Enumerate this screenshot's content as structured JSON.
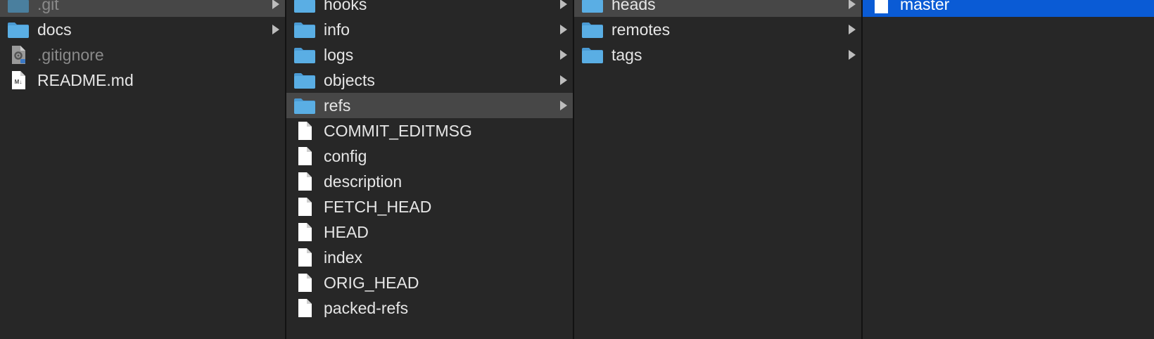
{
  "columns": [
    {
      "items": [
        {
          "label": ".git",
          "kind": "folder",
          "icon": "folder-icon",
          "state": "selected-parent",
          "dim": true,
          "has_children": true
        },
        {
          "label": "docs",
          "kind": "folder",
          "icon": "folder-icon",
          "state": "",
          "dim": false,
          "has_children": true
        },
        {
          "label": ".gitignore",
          "kind": "config-file",
          "icon": "gear-document-icon",
          "state": "",
          "dim": true,
          "has_children": false
        },
        {
          "label": "README.md",
          "kind": "markdown-file",
          "icon": "markdown-document-icon",
          "state": "",
          "dim": false,
          "has_children": false
        }
      ]
    },
    {
      "items": [
        {
          "label": "hooks",
          "kind": "folder",
          "icon": "folder-icon",
          "state": "",
          "dim": false,
          "has_children": true
        },
        {
          "label": "info",
          "kind": "folder",
          "icon": "folder-icon",
          "state": "",
          "dim": false,
          "has_children": true
        },
        {
          "label": "logs",
          "kind": "folder",
          "icon": "folder-icon",
          "state": "",
          "dim": false,
          "has_children": true
        },
        {
          "label": "objects",
          "kind": "folder",
          "icon": "folder-icon",
          "state": "",
          "dim": false,
          "has_children": true
        },
        {
          "label": "refs",
          "kind": "folder",
          "icon": "folder-icon",
          "state": "selected-parent",
          "dim": false,
          "has_children": true
        },
        {
          "label": "COMMIT_EDITMSG",
          "kind": "file",
          "icon": "document-icon",
          "state": "",
          "dim": false,
          "has_children": false
        },
        {
          "label": "config",
          "kind": "file",
          "icon": "document-icon",
          "state": "",
          "dim": false,
          "has_children": false
        },
        {
          "label": "description",
          "kind": "file",
          "icon": "document-icon",
          "state": "",
          "dim": false,
          "has_children": false
        },
        {
          "label": "FETCH_HEAD",
          "kind": "file",
          "icon": "document-icon",
          "state": "",
          "dim": false,
          "has_children": false
        },
        {
          "label": "HEAD",
          "kind": "file",
          "icon": "document-icon",
          "state": "",
          "dim": false,
          "has_children": false
        },
        {
          "label": "index",
          "kind": "file",
          "icon": "document-icon",
          "state": "",
          "dim": false,
          "has_children": false
        },
        {
          "label": "ORIG_HEAD",
          "kind": "file",
          "icon": "document-icon",
          "state": "",
          "dim": false,
          "has_children": false
        },
        {
          "label": "packed-refs",
          "kind": "file",
          "icon": "document-icon",
          "state": "",
          "dim": false,
          "has_children": false
        }
      ]
    },
    {
      "items": [
        {
          "label": "heads",
          "kind": "folder",
          "icon": "folder-icon",
          "state": "selected-parent",
          "dim": false,
          "has_children": true
        },
        {
          "label": "remotes",
          "kind": "folder",
          "icon": "folder-icon",
          "state": "",
          "dim": false,
          "has_children": true
        },
        {
          "label": "tags",
          "kind": "folder",
          "icon": "folder-icon",
          "state": "",
          "dim": false,
          "has_children": true
        }
      ]
    },
    {
      "items": [
        {
          "label": "master",
          "kind": "file",
          "icon": "document-icon",
          "state": "selected-active",
          "dim": false,
          "has_children": false
        }
      ]
    }
  ],
  "colors": {
    "background": "#272727",
    "divider": "#121212",
    "selected_parent": "#474747",
    "selected_active": "#0a5bd5",
    "folder": "#5aaee4",
    "text": "#e6e6e6",
    "dim_text": "#8a8a8a"
  }
}
